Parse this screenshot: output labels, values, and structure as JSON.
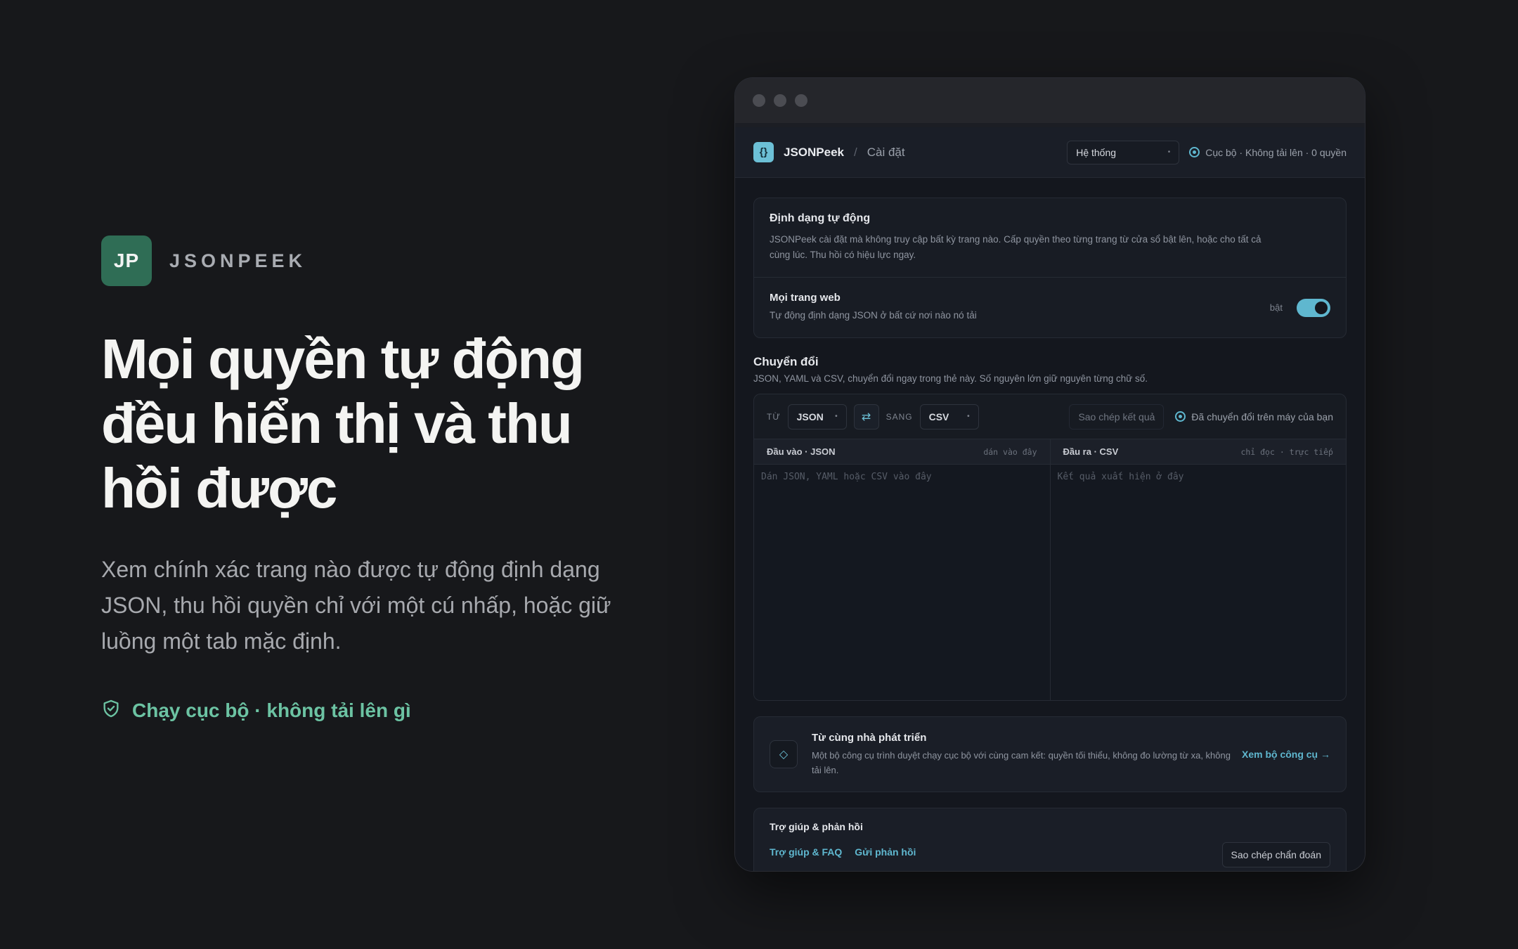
{
  "hero": {
    "logo_initials": "JP",
    "brand_name": "JSONPEEK",
    "headline": "Mọi quyền tự động đều hiển thị và thu hồi được",
    "subhead": "Xem chính xác trang nào được tự động định dạng JSON, thu hồi quyền chỉ với một cú nhấp, hoặc giữ luồng một tab mặc định.",
    "trust_icon": "shield-check-icon",
    "trust_text": "Chạy cục bộ · không tải lên gì"
  },
  "app": {
    "icon_glyph": "{}",
    "name": "JSONPeek",
    "breadcrumb_sep": "/",
    "breadcrumb": "Cài đặt",
    "theme_select_value": "Hệ thống",
    "status_text": "Cục bộ · Không tải lên · 0 quyền"
  },
  "auto_format": {
    "title": "Định dạng tự động",
    "description": "JSONPeek cài đặt mà không truy cập bất kỳ trang nào. Cấp quyền theo từng trang từ cửa sổ bật lên, hoặc cho tất cả cùng lúc. Thu hồi có hiệu lực ngay.",
    "all_sites_title": "Mọi trang web",
    "all_sites_desc": "Tự động định dạng JSON ở bất cứ nơi nào nó tải",
    "toggle_label": "bật",
    "toggle_on": true
  },
  "converter": {
    "title": "Chuyển đổi",
    "description": "JSON, YAML và CSV, chuyển đổi ngay trong thẻ này. Số nguyên lớn giữ nguyên từng chữ số.",
    "from_label": "TỪ",
    "from_value": "JSON",
    "swap_icon": "swap-icon",
    "to_label": "SANG",
    "to_value": "CSV",
    "copy_label": "Sao chép kết quả",
    "status_text": "Đã chuyển đổi trên máy của bạn",
    "input": {
      "title": "Đầu vào · JSON",
      "hint": "dán vào đây",
      "placeholder": "Dán JSON, YAML hoặc CSV vào đây"
    },
    "output": {
      "title": "Đầu ra · CSV",
      "hint": "chỉ đọc · trực tiếp",
      "placeholder": "Kết quả xuất hiện ở đây"
    }
  },
  "promo": {
    "icon": "diamond-icon",
    "title": "Từ cùng nhà phát triển",
    "description": "Một bộ công cụ trình duyệt chạy cục bộ với cùng cam kết: quyền tối thiểu, không đo lường từ xa, không tải lên.",
    "link": "Xem bộ công cụ →"
  },
  "help": {
    "title": "Trợ giúp & phản hồi",
    "faq_link": "Trợ giúp & FAQ",
    "feedback_link": "Gửi phản hồi",
    "diagnostics_button": "Sao chép chẩn đoán"
  },
  "colors": {
    "background": "#17181b",
    "brand_green": "#2f6d55",
    "accent_teal": "#5fb7cf",
    "trust_green": "#6cc3a3"
  }
}
